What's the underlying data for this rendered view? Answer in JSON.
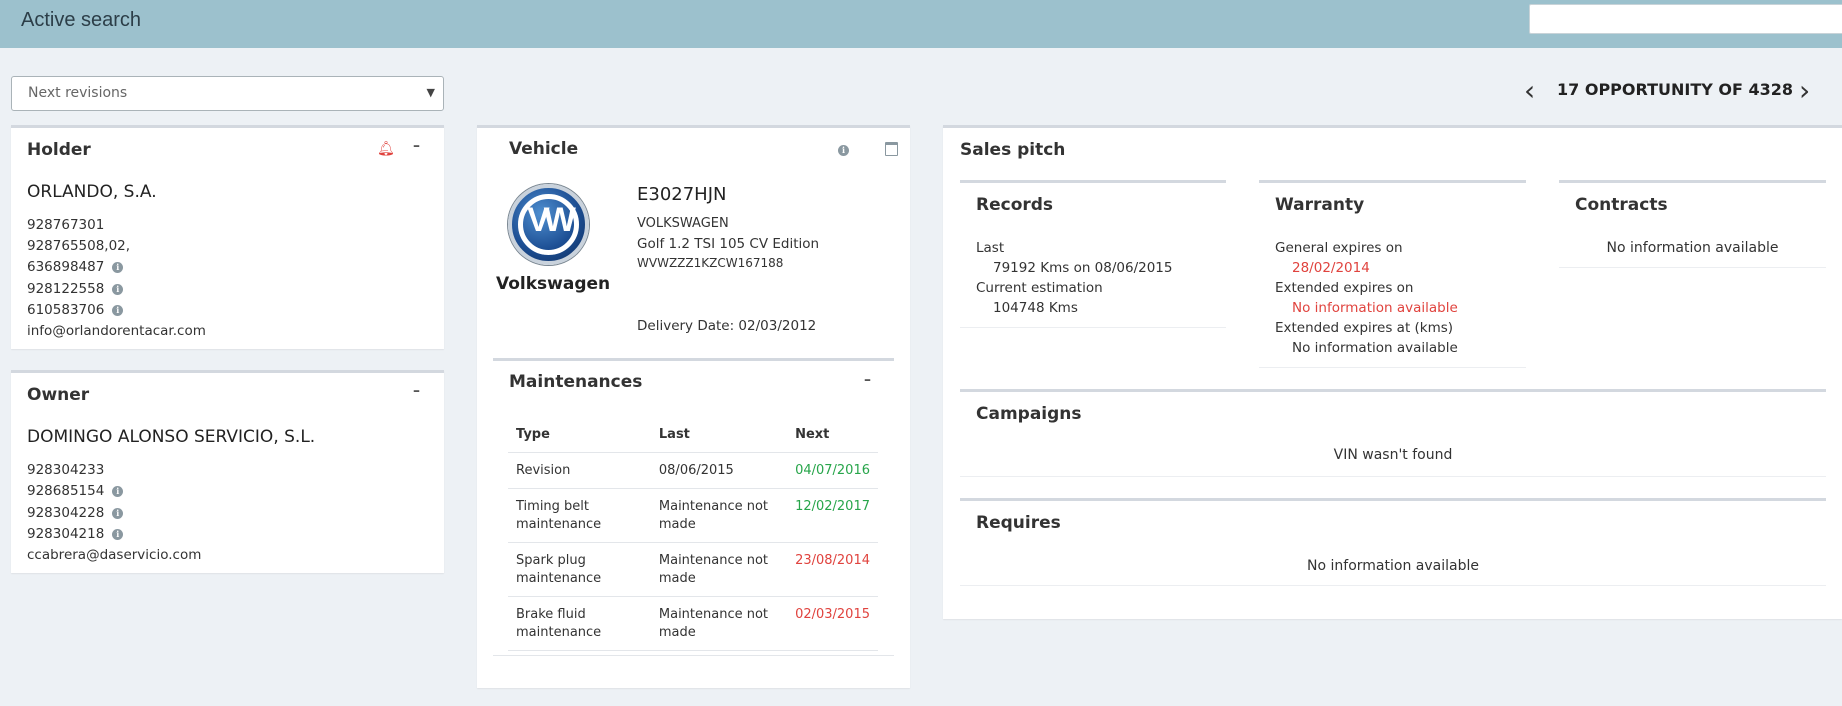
{
  "header": {
    "title": "Active search",
    "search_value": ""
  },
  "filter": {
    "selected": "Next revisions"
  },
  "pager": {
    "label": "17 OPPORTUNITY OF 4328"
  },
  "holder": {
    "title": "Holder",
    "name": "ORLANDO, S.A.",
    "phones": [
      "928767301",
      "928765508,02,",
      "636898487",
      "928122558",
      "610583706"
    ],
    "email": "info@orlandorentacar.com"
  },
  "owner": {
    "title": "Owner",
    "name": "DOMINGO ALONSO SERVICIO, S.L.",
    "phones": [
      "928304233",
      "928685154",
      "928304228",
      "928304218"
    ],
    "email": "ccabrera@daservicio.com"
  },
  "vehicle": {
    "title": "Vehicle",
    "brand_label": "Volkswagen",
    "plate": "E3027HJN",
    "make": "VOLKSWAGEN",
    "model": "Golf 1.2 TSI 105 CV Edition",
    "vin": "WVWZZZ1KZCW167188",
    "delivery": "Delivery Date: 02/03/2012"
  },
  "maintenances": {
    "title": "Maintenances",
    "columns": [
      "Type",
      "Last",
      "Next"
    ],
    "rows": [
      {
        "type": "Revision",
        "last": "08/06/2015",
        "next": "04/07/2016",
        "status": "ok"
      },
      {
        "type": "Timing belt maintenance",
        "last": "Maintenance not made",
        "next": "12/02/2017",
        "status": "ok"
      },
      {
        "type": "Spark plug maintenance",
        "last": "Maintenance not made",
        "next": "23/08/2014",
        "status": "overdue"
      },
      {
        "type": "Brake fluid maintenance",
        "last": "Maintenance not made",
        "next": "02/03/2015",
        "status": "overdue"
      }
    ]
  },
  "sales": {
    "title": "Sales pitch",
    "records": {
      "title": "Records",
      "last_label": "Last",
      "last_value": "79192 Kms on 08/06/2015",
      "estimation_label": "Current estimation",
      "estimation_value": "104748 Kms"
    },
    "warranty": {
      "title": "Warranty",
      "general_label": "General expires on",
      "general_value": "28/02/2014",
      "extended_label": "Extended expires on",
      "extended_value": "No information available",
      "extended_kms_label": "Extended expires at (kms)",
      "extended_kms_value": "No information available"
    },
    "contracts": {
      "title": "Contracts",
      "message": "No information available"
    },
    "campaigns": {
      "title": "Campaigns",
      "message": "VIN wasn't found"
    },
    "requires": {
      "title": "Requires",
      "message": "No information available"
    }
  },
  "colors": {
    "topbar": "#9cc1cd",
    "background": "#edf1f5",
    "ok": "#27a54a",
    "overdue": "#e0433e"
  }
}
